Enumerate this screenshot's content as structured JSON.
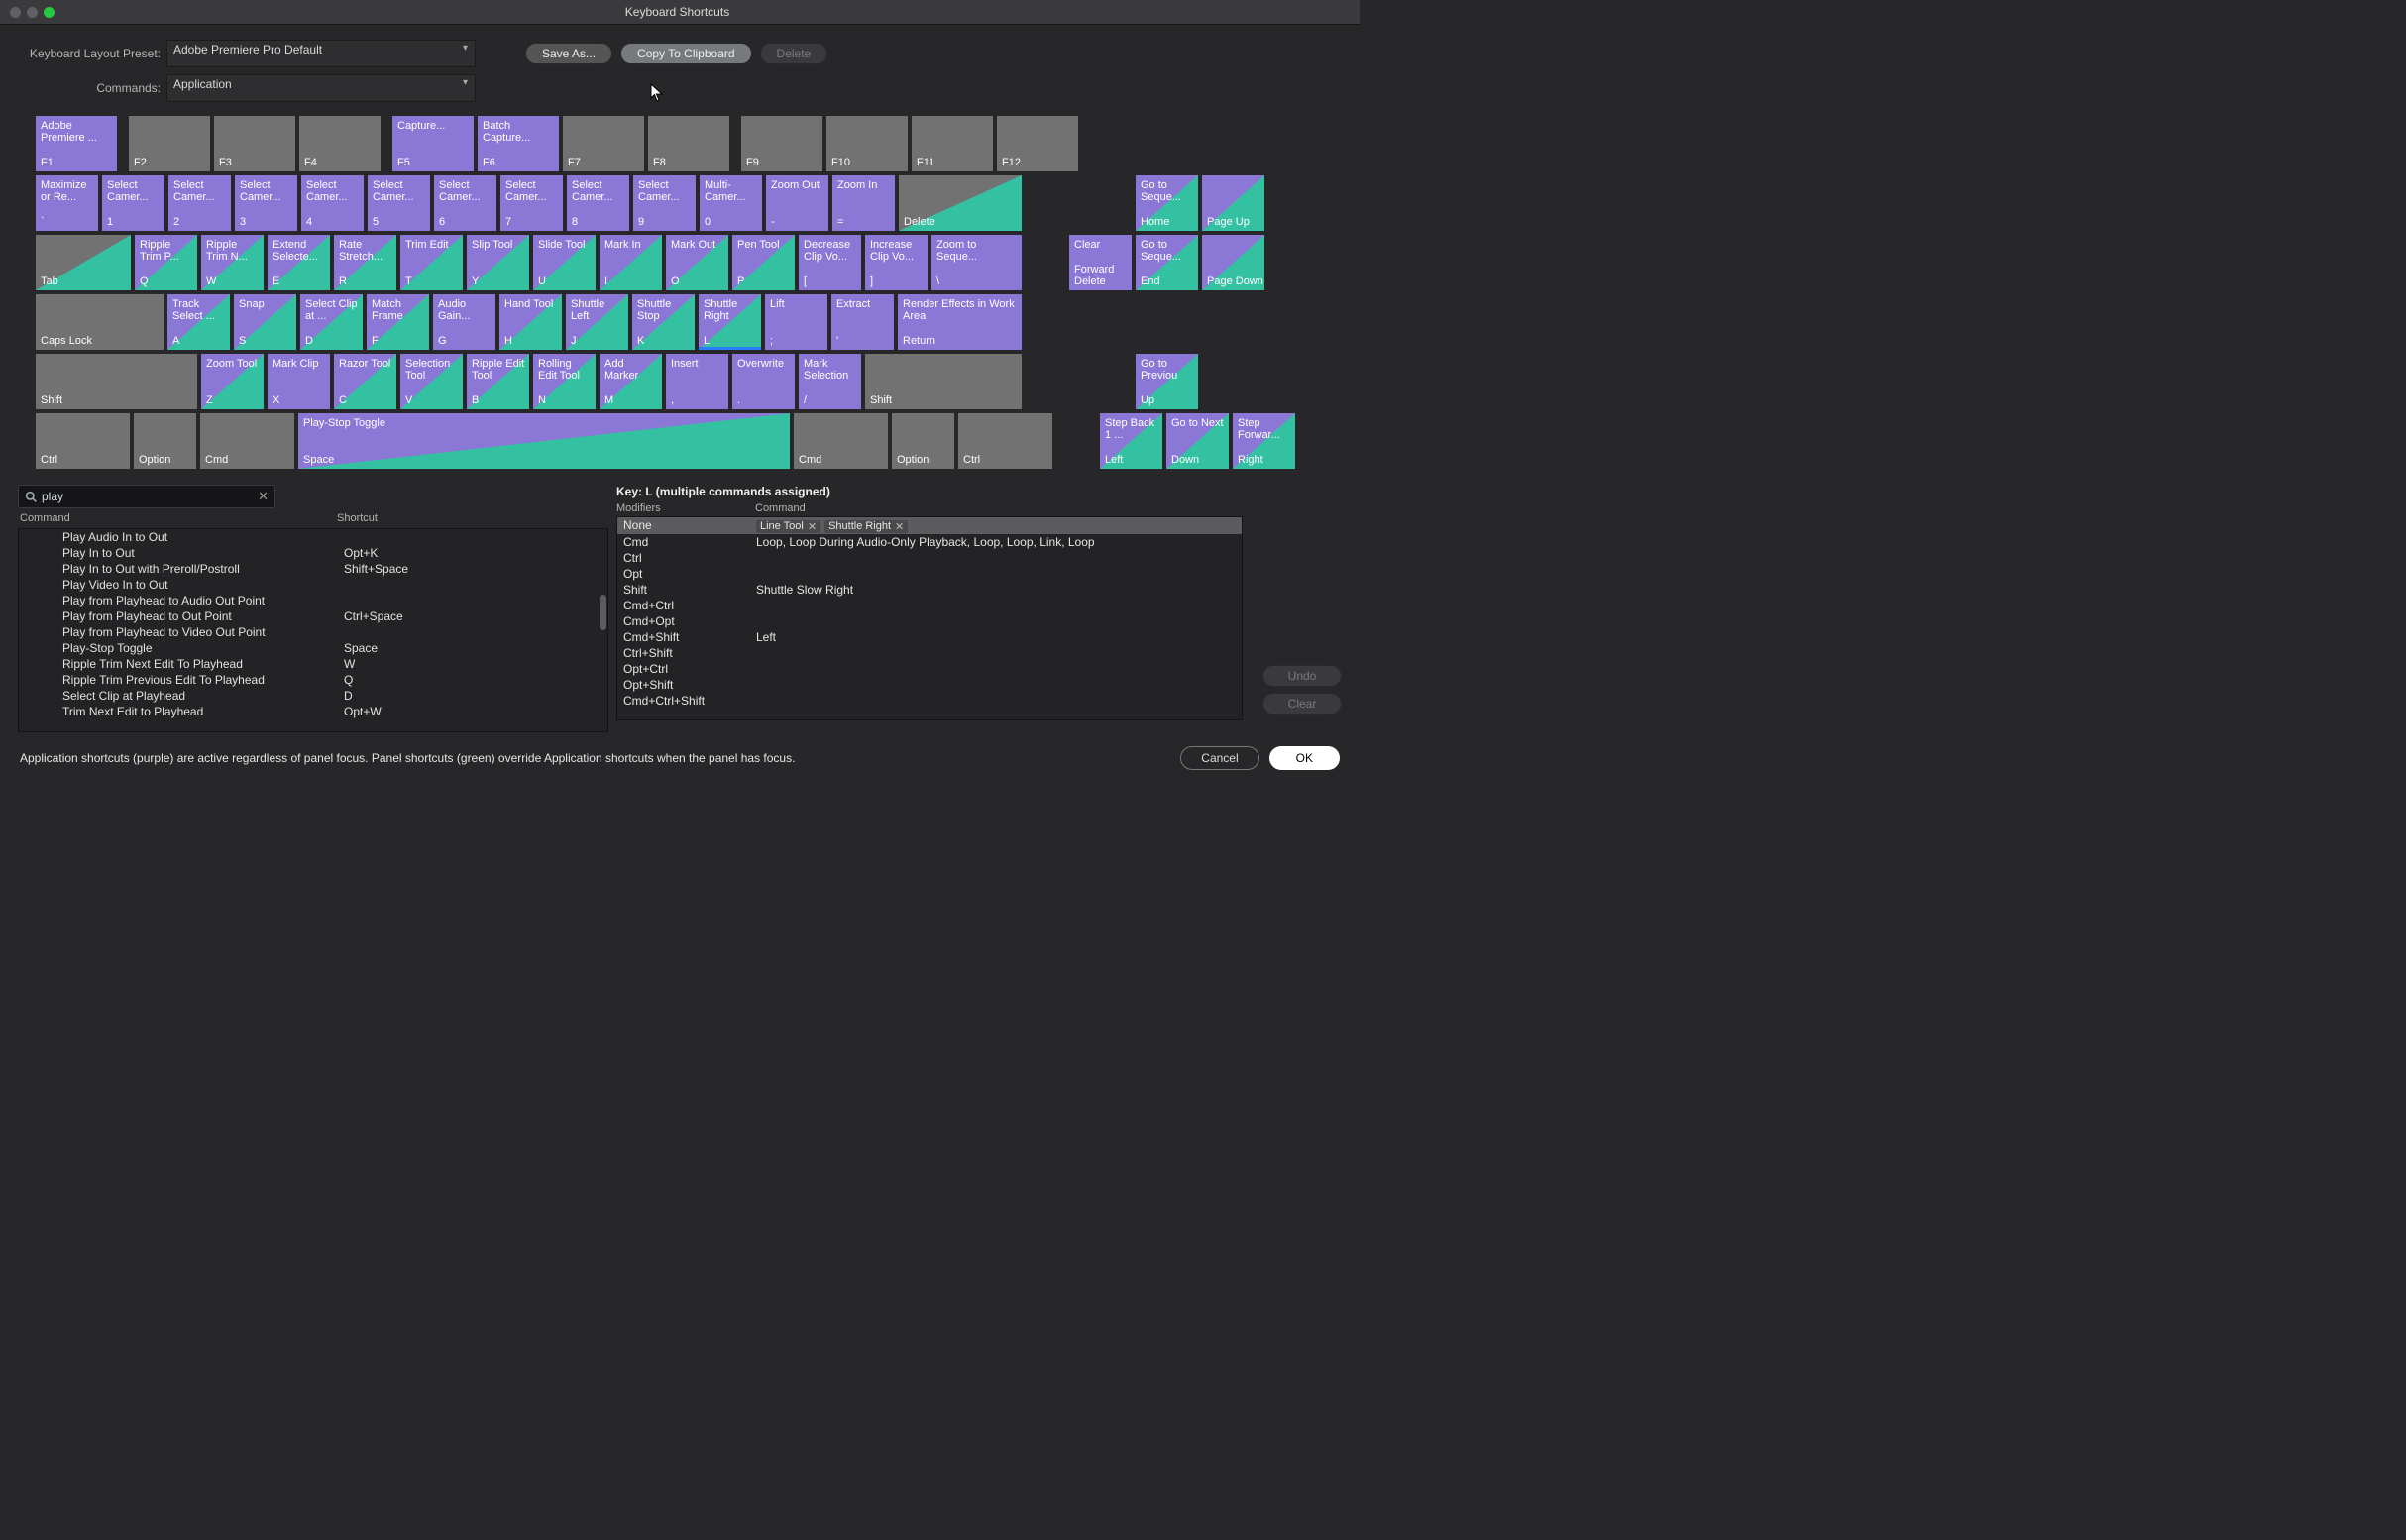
{
  "window": {
    "title": "Keyboard Shortcuts"
  },
  "preset_label": "Keyboard Layout Preset:",
  "preset_value": "Adobe Premiere Pro Default",
  "commands_label": "Commands:",
  "commands_value": "Application",
  "buttons": {
    "save": "Save As...",
    "copy": "Copy To Clipboard",
    "delete": "Delete",
    "undo": "Undo",
    "clear": "Clear",
    "cancel": "Cancel",
    "ok": "OK"
  },
  "search": {
    "value": "play"
  },
  "list_headers": {
    "command": "Command",
    "shortcut": "Shortcut"
  },
  "command_list": [
    {
      "c": "Play Audio In to Out",
      "s": ""
    },
    {
      "c": "Play In to Out",
      "s": "Opt+K"
    },
    {
      "c": "Play In to Out with Preroll/Postroll",
      "s": "Shift+Space"
    },
    {
      "c": "Play Video In to Out",
      "s": ""
    },
    {
      "c": "Play from Playhead to Audio Out Point",
      "s": ""
    },
    {
      "c": "Play from Playhead to Out Point",
      "s": "Ctrl+Space"
    },
    {
      "c": "Play from Playhead to Video Out Point",
      "s": ""
    },
    {
      "c": "Play-Stop Toggle",
      "s": "Space"
    },
    {
      "c": "Ripple Trim Next Edit To Playhead",
      "s": "W"
    },
    {
      "c": "Ripple Trim Previous Edit To Playhead",
      "s": "Q"
    },
    {
      "c": "Select Clip at Playhead",
      "s": "D"
    },
    {
      "c": "Trim Next Edit to Playhead",
      "s": "Opt+W"
    }
  ],
  "key_info": {
    "title": "Key:  L (multiple commands assigned)"
  },
  "mod_headers": {
    "m": "Modifiers",
    "c": "Command"
  },
  "mod_rows": [
    {
      "m": "None",
      "tags": [
        "Line Tool",
        "Shuttle Right"
      ],
      "sel": true
    },
    {
      "m": "Cmd",
      "txt": "Loop, Loop During Audio-Only Playback, Loop, Loop, Link, Loop"
    },
    {
      "m": "Ctrl"
    },
    {
      "m": "Opt"
    },
    {
      "m": "Shift",
      "txt": "Shuttle Slow Right"
    },
    {
      "m": "Cmd+Ctrl"
    },
    {
      "m": "Cmd+Opt"
    },
    {
      "m": "Cmd+Shift",
      "txt": "Left"
    },
    {
      "m": "Ctrl+Shift"
    },
    {
      "m": "Opt+Ctrl"
    },
    {
      "m": "Opt+Shift"
    },
    {
      "m": "Cmd+Ctrl+Shift"
    }
  ],
  "hint": "Application shortcuts (purple) are active regardless of panel focus. Panel shortcuts (green) override Application shortcuts when the panel has focus.",
  "keys": {
    "f1": {
      "c": "Adobe Premiere ...",
      "l": "F1"
    },
    "f2": {
      "l": "F2"
    },
    "f3": {
      "l": "F3"
    },
    "f4": {
      "l": "F4"
    },
    "f5": {
      "c": "Capture...",
      "l": "F5"
    },
    "f6": {
      "c": "Batch Capture...",
      "l": "F6"
    },
    "f7": {
      "l": "F7"
    },
    "f8": {
      "l": "F8"
    },
    "f9": {
      "l": "F9"
    },
    "f10": {
      "l": "F10"
    },
    "f11": {
      "l": "F11"
    },
    "f12": {
      "l": "F12"
    },
    "tick": {
      "c": "Maximize or Re...",
      "l": "`"
    },
    "n1": {
      "c": "Select Camer...",
      "l": "1"
    },
    "n2": {
      "c": "Select Camer...",
      "l": "2"
    },
    "n3": {
      "c": "Select Camer...",
      "l": "3"
    },
    "n4": {
      "c": "Select Camer...",
      "l": "4"
    },
    "n5": {
      "c": "Select Camer...",
      "l": "5"
    },
    "n6": {
      "c": "Select Camer...",
      "l": "6"
    },
    "n7": {
      "c": "Select Camer...",
      "l": "7"
    },
    "n8": {
      "c": "Select Camer...",
      "l": "8"
    },
    "n9": {
      "c": "Select Camer...",
      "l": "9"
    },
    "n0": {
      "c": "Multi-Camer...",
      "l": "0"
    },
    "minus": {
      "c": "Zoom Out",
      "l": "-"
    },
    "eq": {
      "c": "Zoom In",
      "l": "="
    },
    "del": {
      "l": "Delete"
    },
    "home": {
      "c": "Go to Seque...",
      "l": "Home"
    },
    "pgup": {
      "l": "Page Up"
    },
    "tab": {
      "l": "Tab"
    },
    "q": {
      "c": "Ripple Trim P...",
      "l": "Q"
    },
    "w": {
      "c": "Ripple Trim N...",
      "l": "W"
    },
    "e": {
      "c": "Extend Selecte...",
      "l": "E"
    },
    "r": {
      "c": "Rate Stretch...",
      "l": "R"
    },
    "t": {
      "c": "Trim Edit",
      "l": "T"
    },
    "y": {
      "c": "Slip Tool",
      "l": "Y"
    },
    "u": {
      "c": "Slide Tool",
      "l": "U"
    },
    "i": {
      "c": "Mark In",
      "l": "I"
    },
    "o": {
      "c": "Mark Out",
      "l": "O"
    },
    "p": {
      "c": "Pen Tool",
      "l": "P"
    },
    "lb": {
      "c": "Decrease Clip Vo...",
      "l": "["
    },
    "rb": {
      "c": "Increase Clip Vo...",
      "l": "]"
    },
    "bs": {
      "c": "Zoom to Seque...",
      "l": "\\"
    },
    "fdel": {
      "c": "Clear",
      "l": "Forward Delete"
    },
    "end": {
      "c": "Go to Seque...",
      "l": "End"
    },
    "pgdn": {
      "l": "Page Down"
    },
    "caps": {
      "l": "Caps Lock"
    },
    "a": {
      "c": "Track Select ...",
      "l": "A"
    },
    "s": {
      "c": "Snap",
      "l": "S"
    },
    "d": {
      "c": "Select Clip at ...",
      "l": "D"
    },
    "f": {
      "c": "Match Frame",
      "l": "F"
    },
    "g": {
      "c": "Audio Gain...",
      "l": "G"
    },
    "h": {
      "c": "Hand Tool",
      "l": "H"
    },
    "j": {
      "c": "Shuttle Left",
      "l": "J"
    },
    "k": {
      "c": "Shuttle Stop",
      "l": "K"
    },
    "l": {
      "c": "Shuttle Right",
      "l": "L"
    },
    "semi": {
      "c": "Lift",
      "l": ";"
    },
    "apo": {
      "c": "Extract",
      "l": "'"
    },
    "ret": {
      "c": "Render Effects in Work Area",
      "l": "Return"
    },
    "lshift": {
      "l": "Shift"
    },
    "z": {
      "c": "Zoom Tool",
      "l": "Z"
    },
    "x": {
      "c": "Mark Clip",
      "l": "X"
    },
    "c": {
      "c": "Razor Tool",
      "l": "C"
    },
    "v": {
      "c": "Selection Tool",
      "l": "V"
    },
    "b": {
      "c": "Ripple Edit Tool",
      "l": "B"
    },
    "n": {
      "c": "Rolling Edit Tool",
      "l": "N"
    },
    "m": {
      "c": "Add Marker",
      "l": "M"
    },
    "comma": {
      "c": "Insert",
      "l": ","
    },
    "dot": {
      "c": "Overwrite",
      "l": "."
    },
    "slash": {
      "c": "Mark Selection",
      "l": "/"
    },
    "rshift": {
      "l": "Shift"
    },
    "up": {
      "c": "Go to Previou",
      "l": "Up"
    },
    "lctrl": {
      "l": "Ctrl"
    },
    "lopt": {
      "l": "Option"
    },
    "lcmd": {
      "l": "Cmd"
    },
    "space": {
      "c": "Play-Stop Toggle",
      "l": "Space"
    },
    "rcmd": {
      "l": "Cmd"
    },
    "ropt": {
      "l": "Option"
    },
    "rctrl": {
      "l": "Ctrl"
    },
    "left": {
      "c": "Step Back 1 ...",
      "l": "Left"
    },
    "down": {
      "c": "Go to Next",
      "l": "Down"
    },
    "right": {
      "c": "Step Forwar...",
      "l": "Right"
    }
  }
}
